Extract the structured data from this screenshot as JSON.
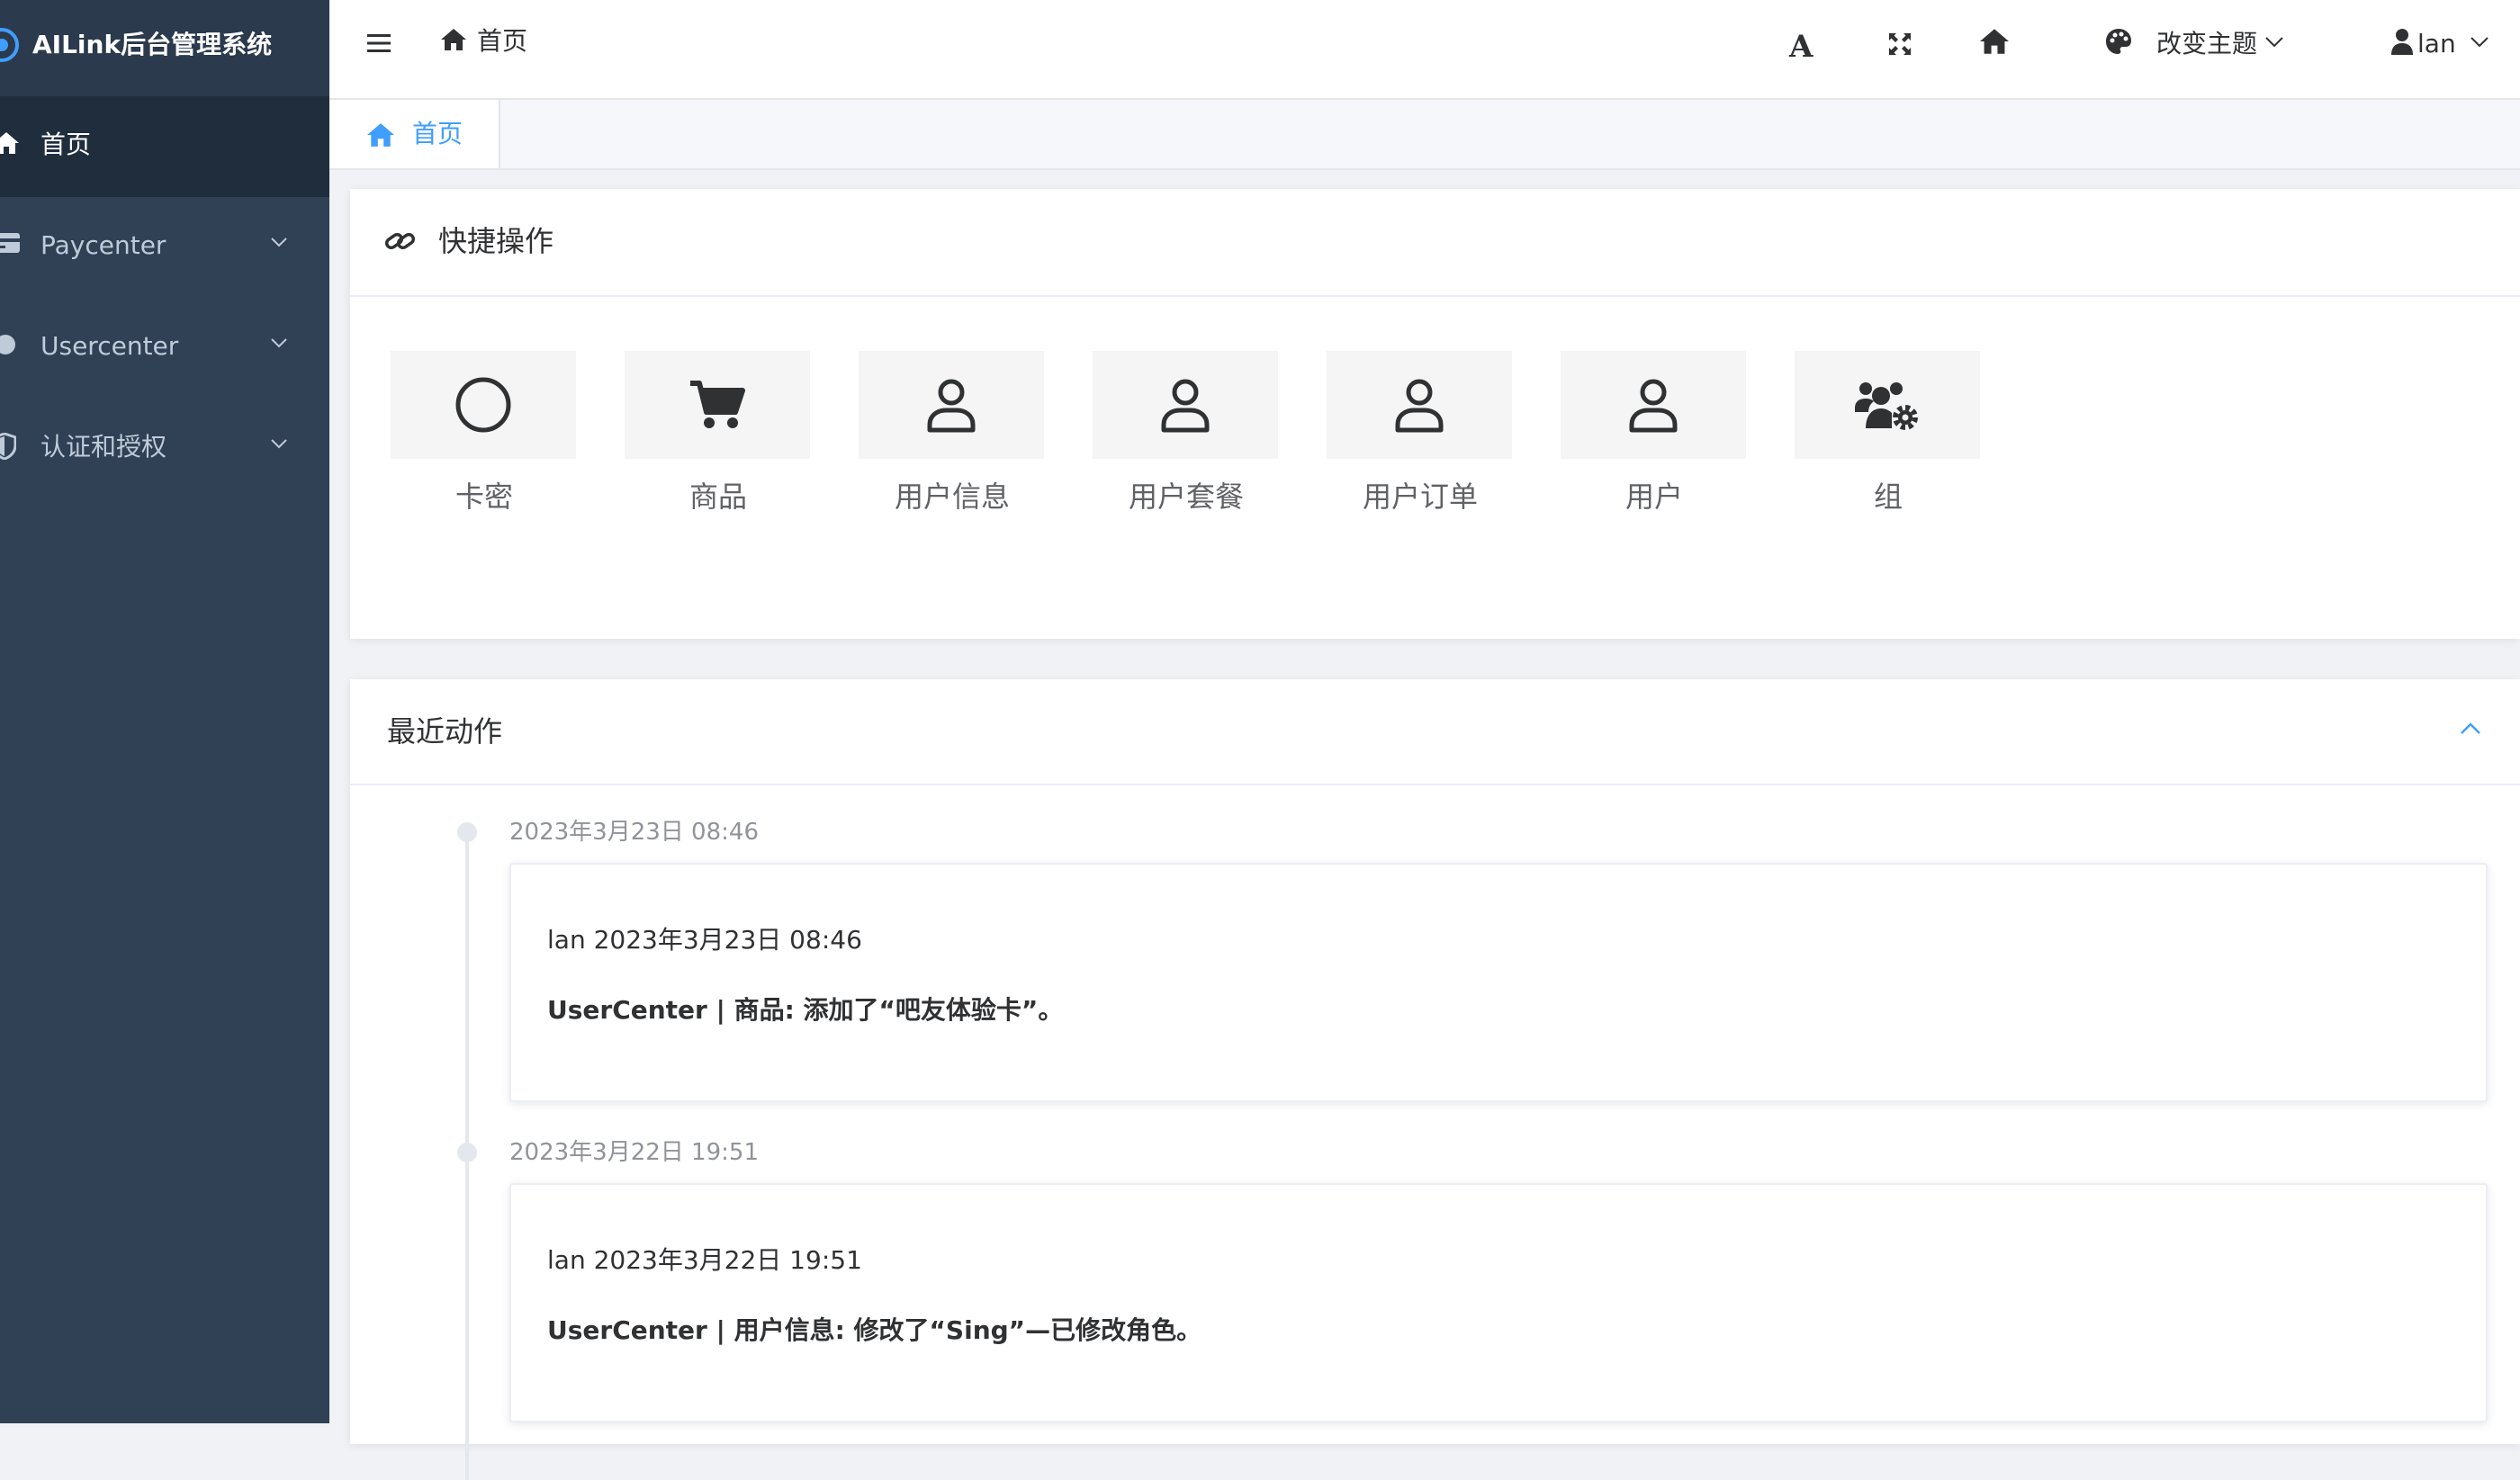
{
  "app": {
    "title": "AILink后台管理系统"
  },
  "sidebar": {
    "items": [
      {
        "label": "首页",
        "icon": "home-icon",
        "active": true
      },
      {
        "label": "Paycenter",
        "icon": "credit-card-icon",
        "expandable": true
      },
      {
        "label": "Usercenter",
        "icon": "circle-icon",
        "expandable": true
      },
      {
        "label": "认证和授权",
        "icon": "shield-icon",
        "expandable": true
      }
    ]
  },
  "navbar": {
    "breadcrumb": "首页",
    "font_size_label": "A",
    "theme_label": "改变主题",
    "user_name": "lan"
  },
  "tags": [
    {
      "label": "首页",
      "active": true
    }
  ],
  "quick_actions": {
    "title": "快捷操作",
    "items": [
      {
        "label": "卡密",
        "icon": "circle-outline-icon"
      },
      {
        "label": "商品",
        "icon": "shopping-cart-icon"
      },
      {
        "label": "用户信息",
        "icon": "user-icon"
      },
      {
        "label": "用户套餐",
        "icon": "user-icon"
      },
      {
        "label": "用户订单",
        "icon": "user-icon"
      },
      {
        "label": "用户",
        "icon": "user-icon"
      },
      {
        "label": "组",
        "icon": "users-cog-icon"
      }
    ]
  },
  "recent_actions": {
    "title": "最近动作",
    "items": [
      {
        "timestamp": "2023年3月23日 08:46",
        "header": "lan 2023年3月23日 08:46",
        "detail": "UserCenter | 商品: 添加了“吧友体验卡”。"
      },
      {
        "timestamp": "2023年3月22日 19:51",
        "header": "lan 2023年3月22日 19:51",
        "detail": "UserCenter | 用户信息: 修改了“Sing”—已修改角色。"
      }
    ]
  },
  "colors": {
    "sidebar_bg": "#304156",
    "sidebar_active_bg": "#1f2d3d",
    "sidebar_text": "#bfcbd9",
    "accent": "#409eff",
    "page_bg": "#f0f2f5"
  }
}
